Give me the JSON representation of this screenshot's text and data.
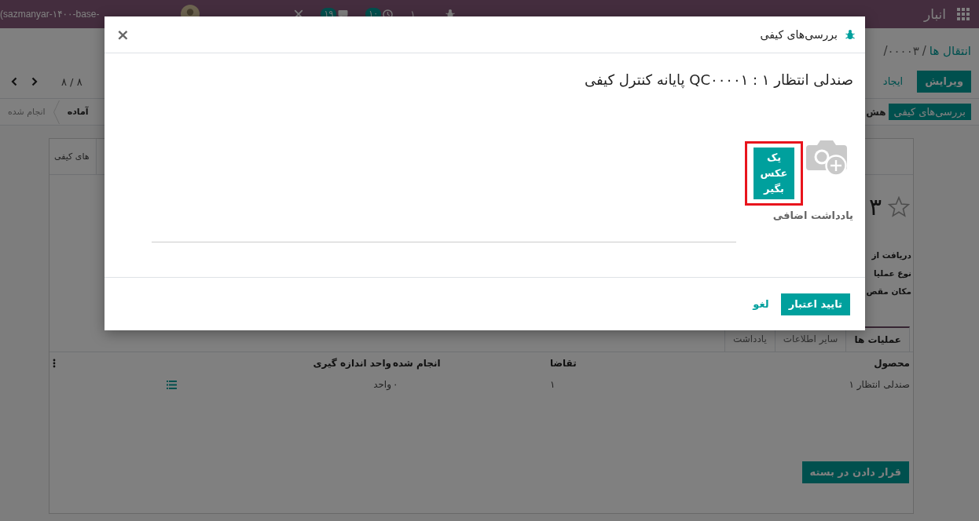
{
  "navbar": {
    "app_name": "انبار",
    "systray": [
      {
        "kind": "plain",
        "count": "۱"
      },
      {
        "kind": "activity",
        "count": "۱۰"
      },
      {
        "kind": "messages",
        "count": "۱۹"
      }
    ],
    "database": "(sazmanyar-۱۴۰۰-base-"
  },
  "control_panel": {
    "breadcrumb": [
      {
        "label": "انتقال ها",
        "kind": "link"
      },
      {
        "label": "/۰۰۰۰۳",
        "kind": "current"
      }
    ],
    "separator": "/",
    "buttons": [
      {
        "label": "ویرایش",
        "kind": "primary"
      },
      {
        "label": "ایجاد",
        "kind": "secondary"
      }
    ],
    "pager": "۸ / ۸"
  },
  "statusbar": {
    "buttons": [
      {
        "label": "بررسی‌های کیفی",
        "kind": "primary"
      },
      {
        "label": "هش",
        "kind": "secondary"
      }
    ],
    "stages": [
      {
        "label": "آماده",
        "selected": true
      },
      {
        "label": "انجام شده",
        "selected": false
      }
    ]
  },
  "sheet": {
    "smart_button": "های کیفی",
    "favorite": false,
    "title": "۳",
    "fields": [
      "دریافت از",
      "نوع عملیا",
      "مکان مقص"
    ],
    "tabs": [
      {
        "label": "عملیات ها",
        "selected": true
      },
      {
        "label": "سایر اطلاعات",
        "selected": false
      },
      {
        "label": "یادداشت",
        "selected": false
      }
    ],
    "table": {
      "columns": [
        "محصول",
        "تقاضا",
        "انجام شده",
        "واحد اندازه گیری"
      ],
      "rows": [
        {
          "cells": [
            "صندلی انتظار ۱",
            "۱",
            "۰",
            "واحد"
          ]
        }
      ]
    },
    "put_in_pack": "قرار دادن در بسته"
  },
  "dialog": {
    "title": "بررسی‌های کیفی",
    "close": "×",
    "heading": "صندلی انتظار ۱ : QC۰۰۰۰۱ پایانه کنترل کیفی",
    "photo_button": {
      "label": "یک عکس بگیر",
      "highlighted": true
    },
    "note_label": "یادداشت اضافی",
    "buttons": [
      {
        "label": "تایید اعتبار",
        "kind": "primary"
      },
      {
        "label": "لغو",
        "kind": "link"
      }
    ]
  }
}
